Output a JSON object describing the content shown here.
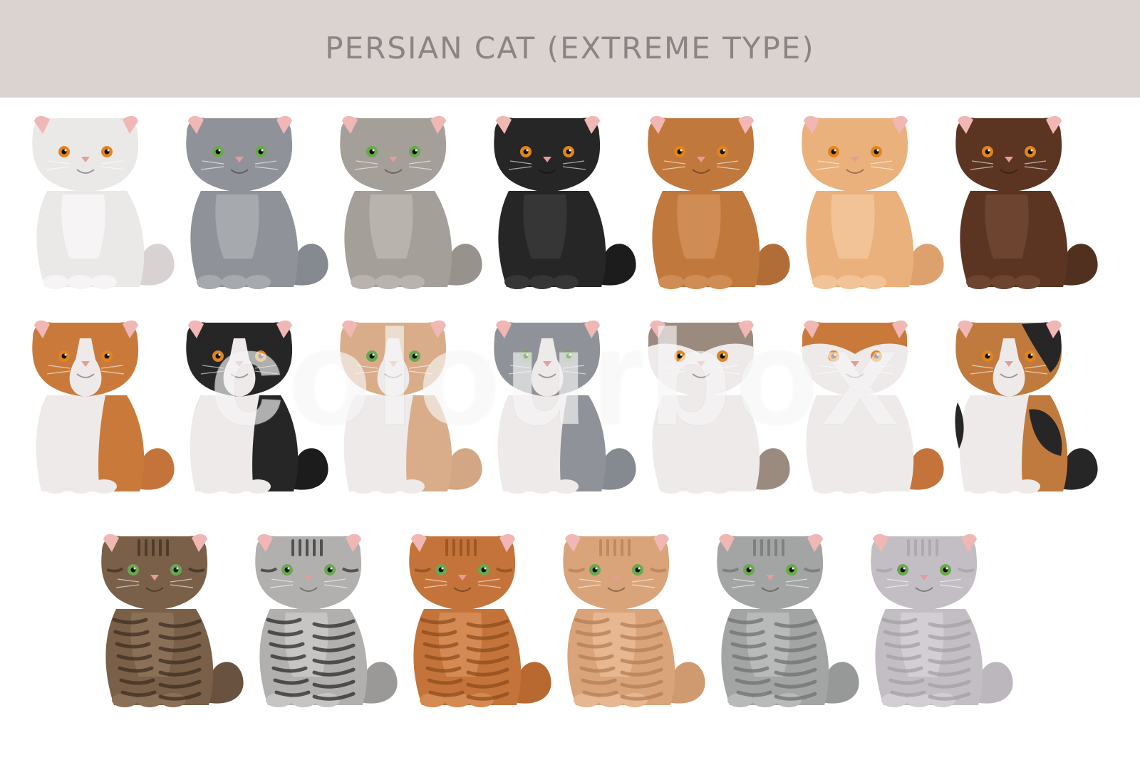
{
  "header": {
    "title": "PERSIAN CAT (EXTREME TYPE)"
  },
  "watermark": {
    "text": "colourbox"
  },
  "cats": [
    {
      "body": "#ebe8e8",
      "chest": "#f6f4f4",
      "dark": "#d2cccc",
      "tail": "#d8d2d2",
      "eye": "#e0851e",
      "pattern": "solid"
    },
    {
      "body": "#8f9399",
      "chest": "#a6aaaf",
      "dark": "#737780",
      "tail": "#858990",
      "eye": "#6aa84f",
      "pattern": "solid"
    },
    {
      "body": "#a49f99",
      "chest": "#b8b3ad",
      "dark": "#88837d",
      "tail": "#97928c",
      "eye": "#6aa84f",
      "pattern": "solid"
    },
    {
      "body": "#262626",
      "chest": "#363636",
      "dark": "#111111",
      "tail": "#1c1c1c",
      "eye": "#e0851e",
      "pattern": "solid"
    },
    {
      "body": "#c0783c",
      "chest": "#cf8d55",
      "dark": "#a36330",
      "tail": "#b06d36",
      "eye": "#e0851e",
      "pattern": "solid"
    },
    {
      "body": "#eab17d",
      "chest": "#f2c396",
      "dark": "#d29965",
      "tail": "#dda16d",
      "eye": "#e0851e",
      "pattern": "solid"
    },
    {
      "body": "#5b3522",
      "chest": "#6c4430",
      "dark": "#442617",
      "tail": "#52301f",
      "eye": "#e0851e",
      "pattern": "solid"
    },
    {
      "body": "#c97a3a",
      "chest": "#eeeaea",
      "dark": "#a86328",
      "tail": "#c4743a",
      "eye": "#e0851e",
      "pattern": "bicolor"
    },
    {
      "body": "#262626",
      "chest": "#eeeaea",
      "dark": "#111111",
      "tail": "#1c1c1c",
      "eye": "#e0851e",
      "pattern": "bicolor"
    },
    {
      "body": "#d9ad8a",
      "chest": "#eeeaea",
      "dark": "#c29575",
      "tail": "#d3a684",
      "eye": "#6aa84f",
      "pattern": "bicolor"
    },
    {
      "body": "#8f9399",
      "chest": "#eeeaea",
      "dark": "#737780",
      "tail": "#858990",
      "eye": "#6aa84f",
      "pattern": "bicolor"
    },
    {
      "body": "#9b8a7e",
      "chest": "#eeeaea",
      "dark": "#857468",
      "tail": "#9b8a7e",
      "eye": "#e0851e",
      "pattern": "van"
    },
    {
      "body": "#c97a3a",
      "chest": "#eeeaea",
      "dark": "#a86328",
      "tail": "#c4743a",
      "eye": "#e0851e",
      "pattern": "van"
    },
    {
      "body": "#c07a3d",
      "chest": "#eeeaea",
      "dark": "#262626",
      "tail": "#262626",
      "eye": "#e0851e",
      "pattern": "calico"
    },
    {
      "body": "#7a6048",
      "chest": "#8b7058",
      "dark": "#3e2e22",
      "tail": "#6a5240",
      "eye": "#6aa84f",
      "pattern": "tabby"
    },
    {
      "body": "#b2b0ae",
      "chest": "#c7c5c3",
      "dark": "#2a2a2a",
      "tail": "#9b9997",
      "eye": "#6aa84f",
      "pattern": "tabby"
    },
    {
      "body": "#c4743a",
      "chest": "#d48a52",
      "dark": "#8f4c1d",
      "tail": "#b8692f",
      "eye": "#6aa84f",
      "pattern": "tabby"
    },
    {
      "body": "#d9a47a",
      "chest": "#e6b790",
      "dark": "#b47e55",
      "tail": "#cf9a6f",
      "eye": "#6aa84f",
      "pattern": "tabby"
    },
    {
      "body": "#a3a4a4",
      "chest": "#b8b9b9",
      "dark": "#6f7070",
      "tail": "#979898",
      "eye": "#6aa84f",
      "pattern": "tabby"
    },
    {
      "body": "#c3bec4",
      "chest": "#d3ced4",
      "dark": "#a49fa6",
      "tail": "#bcb7bd",
      "eye": "#6aa84f",
      "pattern": "tabby"
    }
  ]
}
